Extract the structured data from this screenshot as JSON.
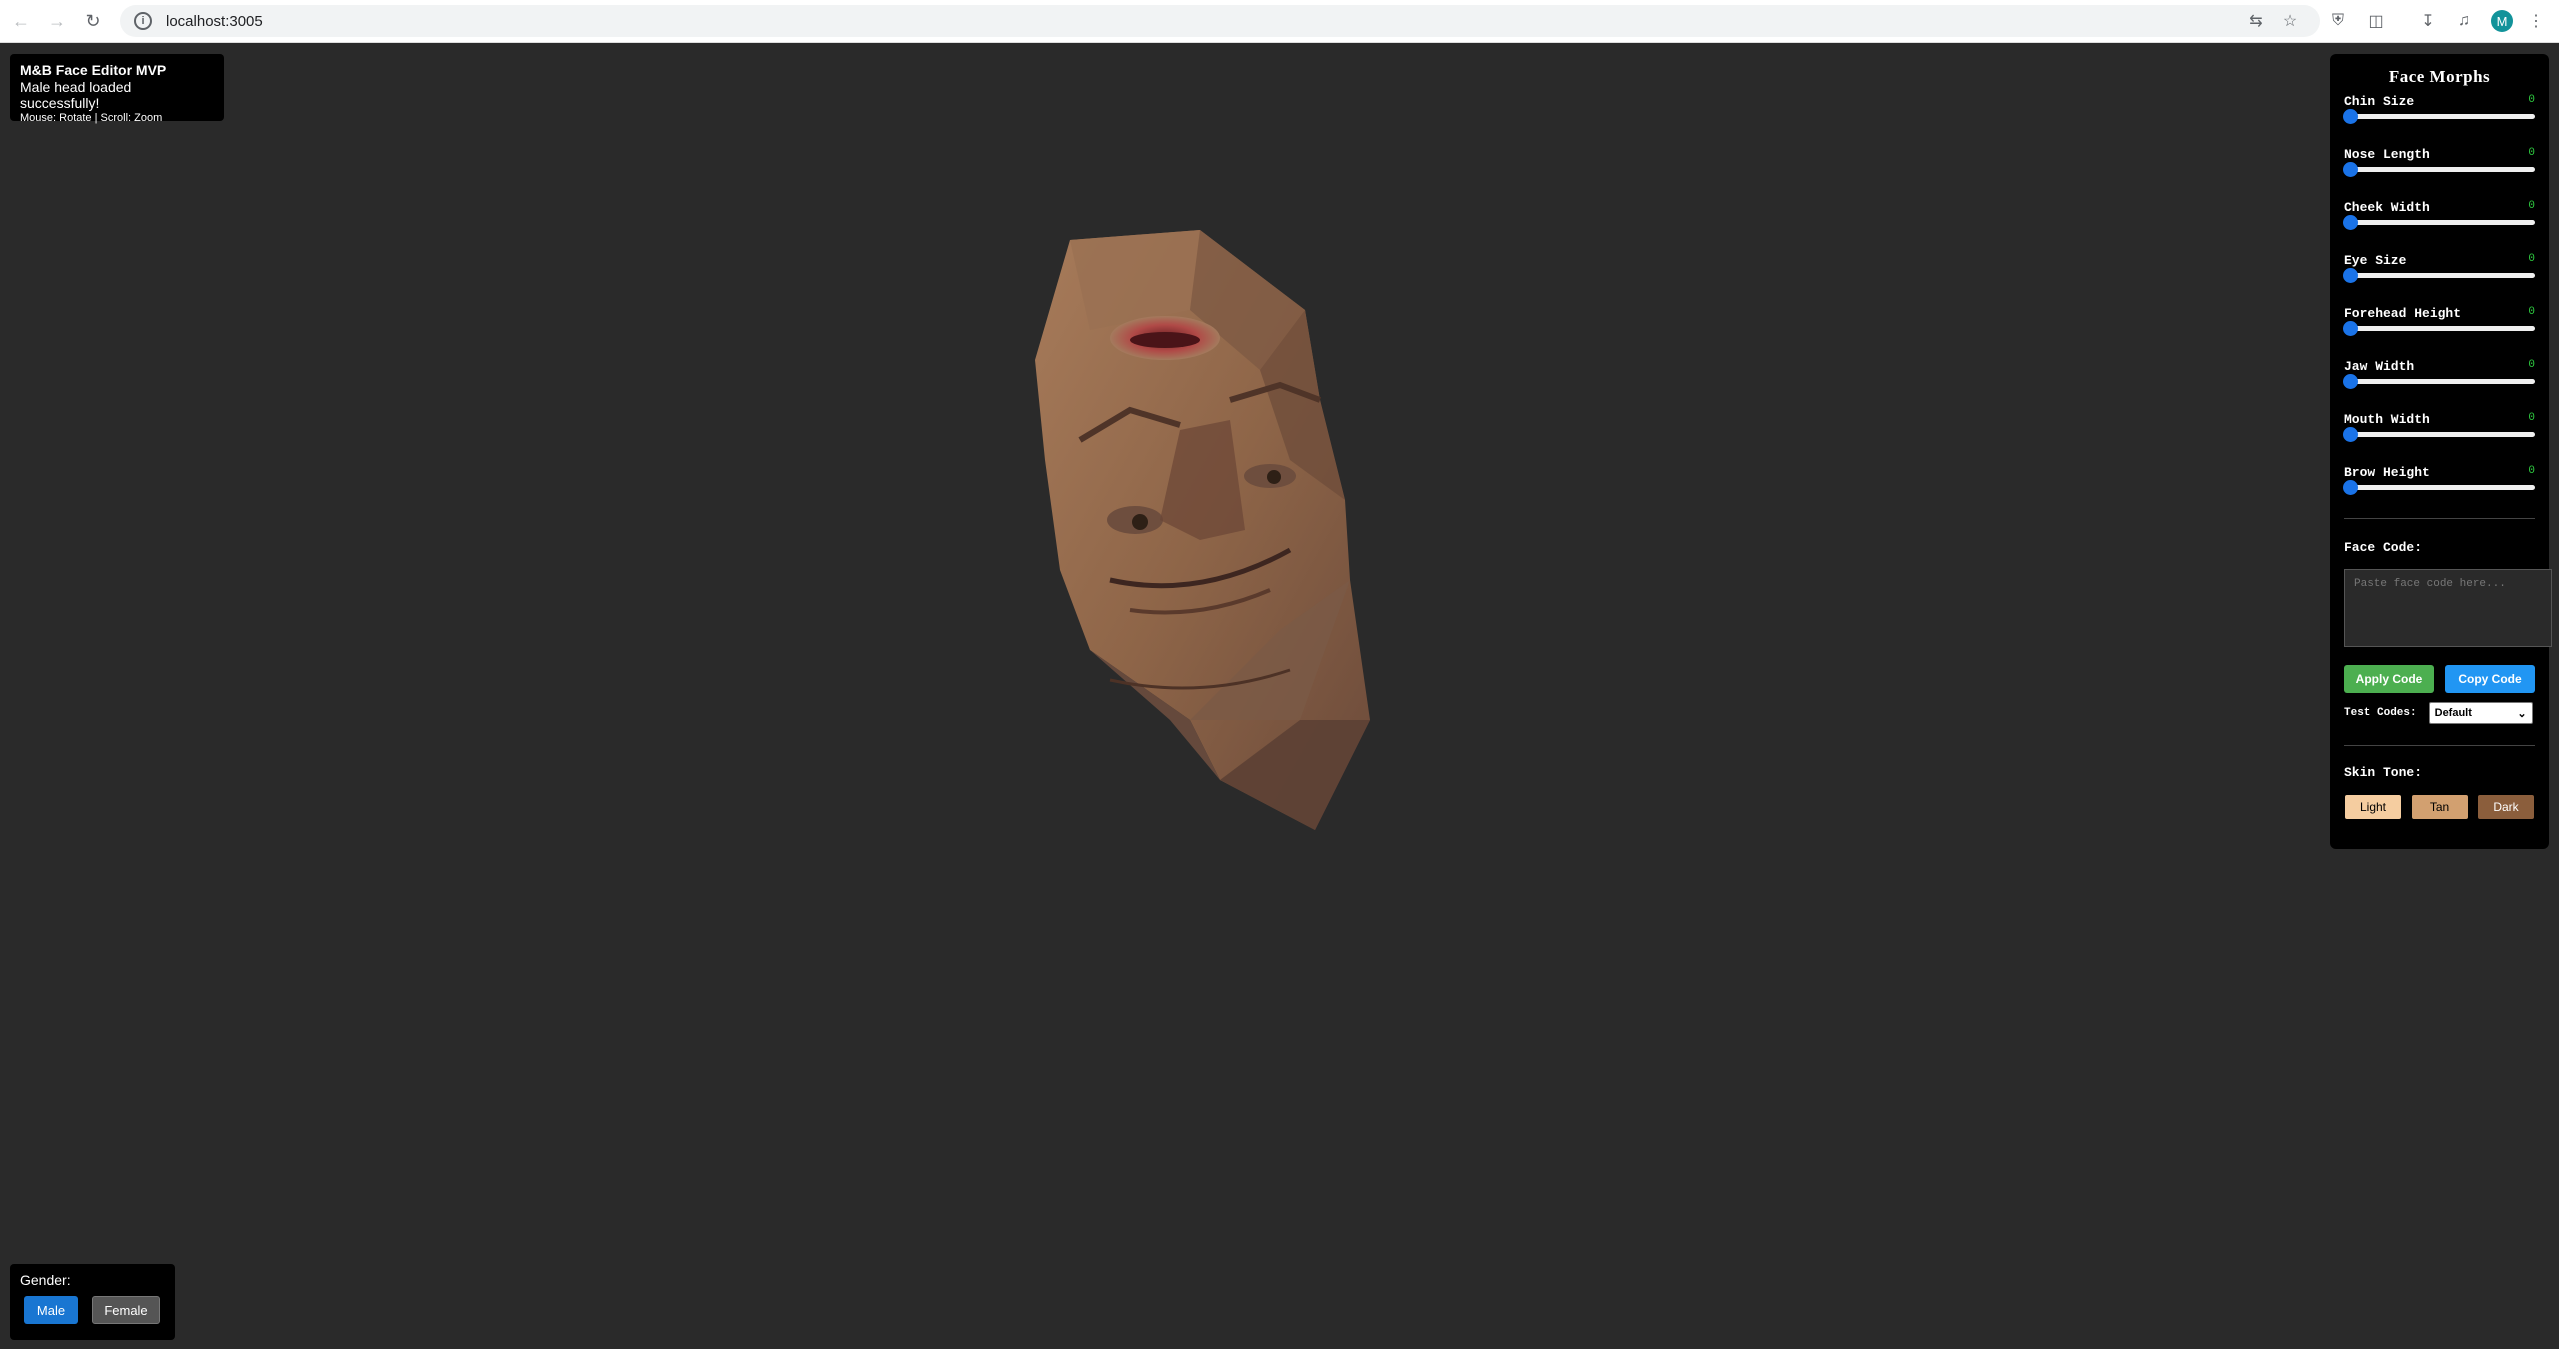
{
  "browser": {
    "url": "localhost:3005",
    "avatar_letter": "M",
    "icons": [
      "back-icon",
      "forward-icon",
      "reload-icon",
      "info-icon",
      "translate-icon",
      "star-icon",
      "shield-icon",
      "extensions-icon",
      "download-icon",
      "media-icon",
      "menu-icon"
    ]
  },
  "info": {
    "title": "M&B Face Editor MVP",
    "status": "Male head loaded successfully!",
    "controls": "Mouse: Rotate | Scroll: Zoom"
  },
  "panel": {
    "title": "Face Morphs",
    "sliders": [
      {
        "label": "Chin Size",
        "value": "0",
        "fraction": 0
      },
      {
        "label": "Nose Length",
        "value": "0",
        "fraction": 0
      },
      {
        "label": "Cheek Width",
        "value": "0",
        "fraction": 0
      },
      {
        "label": "Eye Size",
        "value": "0",
        "fraction": 0
      },
      {
        "label": "Forehead Height",
        "value": "0",
        "fraction": 0
      },
      {
        "label": "Jaw Width",
        "value": "0",
        "fraction": 0
      },
      {
        "label": "Mouth Width",
        "value": "0",
        "fraction": 0
      },
      {
        "label": "Brow Height",
        "value": "0",
        "fraction": 0
      }
    ],
    "face_code_label": "Face Code:",
    "face_code_placeholder": "Paste face code here...",
    "apply_label": "Apply Code",
    "copy_label": "Copy Code",
    "test_codes_label": "Test Codes:",
    "test_codes_selected": "Default",
    "skin_tone_label": "Skin Tone:",
    "skin_tones": [
      {
        "label": "Light",
        "color": "#f5cda0",
        "text": "#000000"
      },
      {
        "label": "Tan",
        "color": "#d2a070",
        "text": "#000000"
      },
      {
        "label": "Dark",
        "color": "#8b5e3c",
        "text": "#ffffff"
      }
    ]
  },
  "gender": {
    "label": "Gender:",
    "male": "Male",
    "female": "Female"
  }
}
